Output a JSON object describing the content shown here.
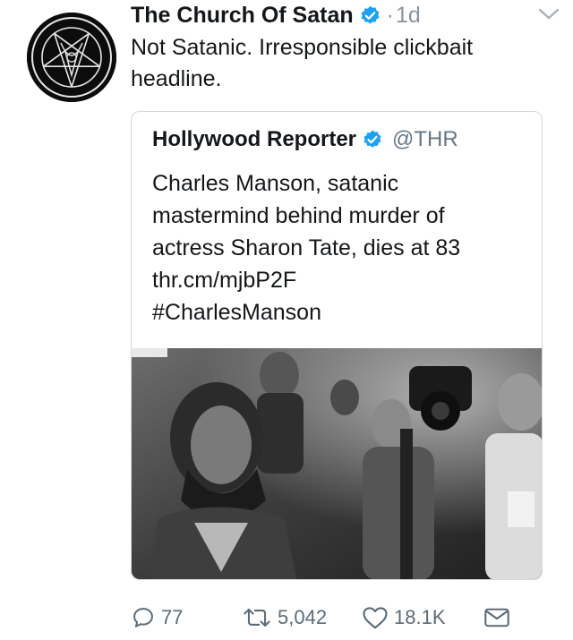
{
  "tweet": {
    "author": "The Church Of Satan",
    "separator": "·",
    "time": "1d",
    "text": "Not Satanic. Irresponsible clickbait headline.",
    "avatar_icon": "sigil-of-baphomet-icon"
  },
  "quoted": {
    "author": "Hollywood Reporter",
    "handle": "@THR",
    "lines": [
      "Charles Manson, satanic",
      "mastermind behind murder of",
      "actress Sharon Tate, dies at 83",
      "thr.cm/mjbP2F",
      "#CharlesManson"
    ]
  },
  "actions": {
    "replies": "77",
    "retweets": "5,042",
    "likes": "18.1K"
  },
  "colors": {
    "verified": "#1da1f2",
    "muted": "#8a939b",
    "border": "#cfd9de"
  }
}
